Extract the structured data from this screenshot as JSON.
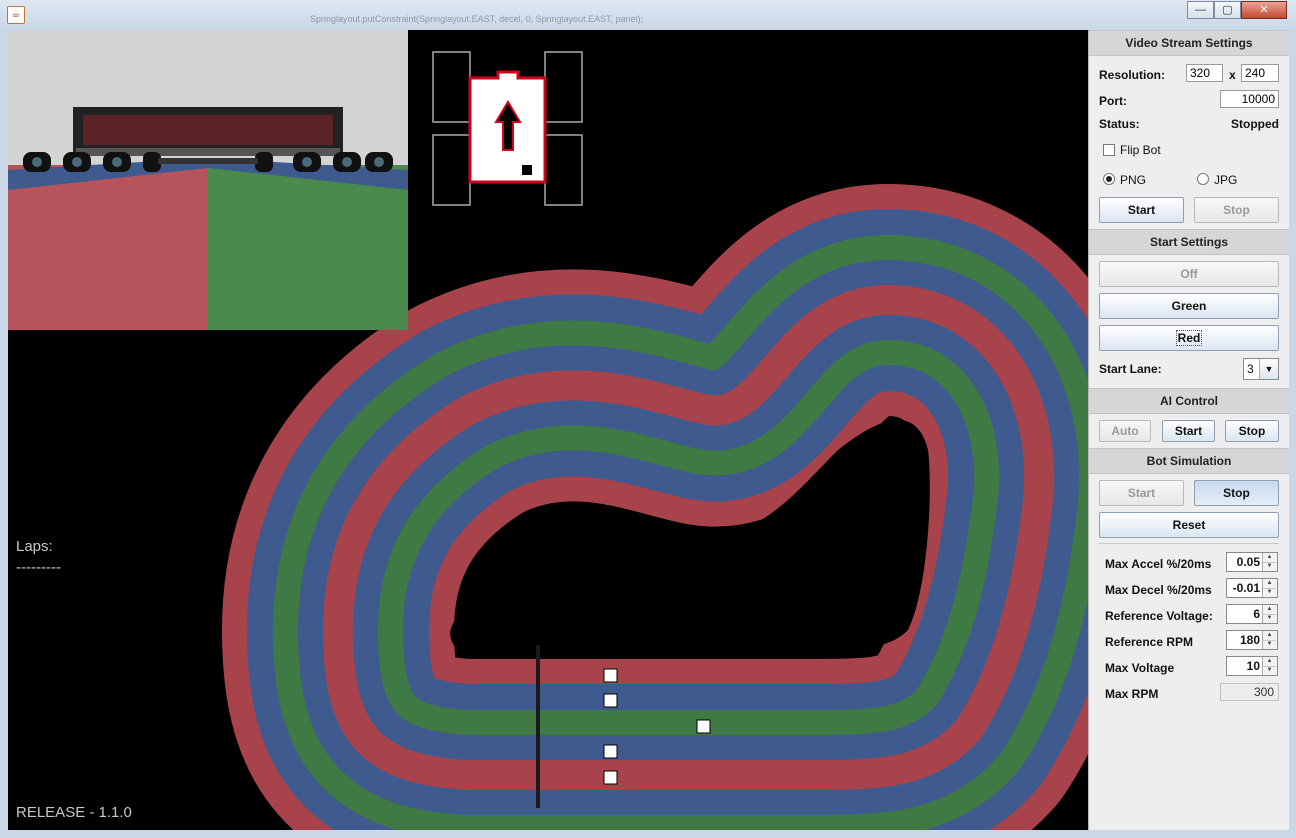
{
  "window": {
    "title_fragments": [
      "Springlayout.putConstraint(Springlayout.EAST, decel, 0, Springlayout.EAST, panel);"
    ],
    "minimize_icon": "minimize-icon",
    "maximize_icon": "maximize-icon",
    "close_icon": "close-icon",
    "colors": {
      "close": "#c44a32",
      "view_bg": "#000000",
      "panel_bg": "#eeeeee"
    }
  },
  "hud": {
    "laps_label": "Laps:",
    "laps_value": "---------",
    "release": "RELEASE - 1.1.0"
  },
  "track": {
    "lane_colors": [
      "#a8434c",
      "#3e5a8e",
      "#3f7a45"
    ],
    "lane_count": 5
  },
  "video_stream": {
    "header": "Video Stream Settings",
    "resolution_label": "Resolution:",
    "width": "320",
    "x_label": "x",
    "height": "240",
    "port_label": "Port:",
    "port": "10000",
    "status_label": "Status:",
    "status_value": "Stopped",
    "flip_bot_label": "Flip Bot",
    "flip_bot_checked": false,
    "format_png": "PNG",
    "format_jpg": "JPG",
    "format_selected": "PNG",
    "start_button": "Start",
    "stop_button": "Stop"
  },
  "start_settings": {
    "header": "Start Settings",
    "off_button": "Off",
    "green_button": "Green",
    "red_button": "Red",
    "start_lane_label": "Start Lane:",
    "start_lane_value": "3"
  },
  "ai_control": {
    "header": "AI Control",
    "auto_button": "Auto",
    "start_button": "Start",
    "stop_button": "Stop"
  },
  "bot_simulation": {
    "header": "Bot Simulation",
    "start_button": "Start",
    "stop_button": "Stop",
    "reset_button": "Reset",
    "max_accel_label": "Max Accel %/20ms",
    "max_accel_value": "0.05",
    "max_decel_label": "Max Decel %/20ms",
    "max_decel_value": "-0.01",
    "ref_voltage_label": "Reference Voltage:",
    "ref_voltage_value": "6",
    "ref_rpm_label": "Reference RPM",
    "ref_rpm_value": "180",
    "max_voltage_label": "Max Voltage",
    "max_voltage_value": "10",
    "max_rpm_label": "Max RPM",
    "max_rpm_value": "300"
  }
}
